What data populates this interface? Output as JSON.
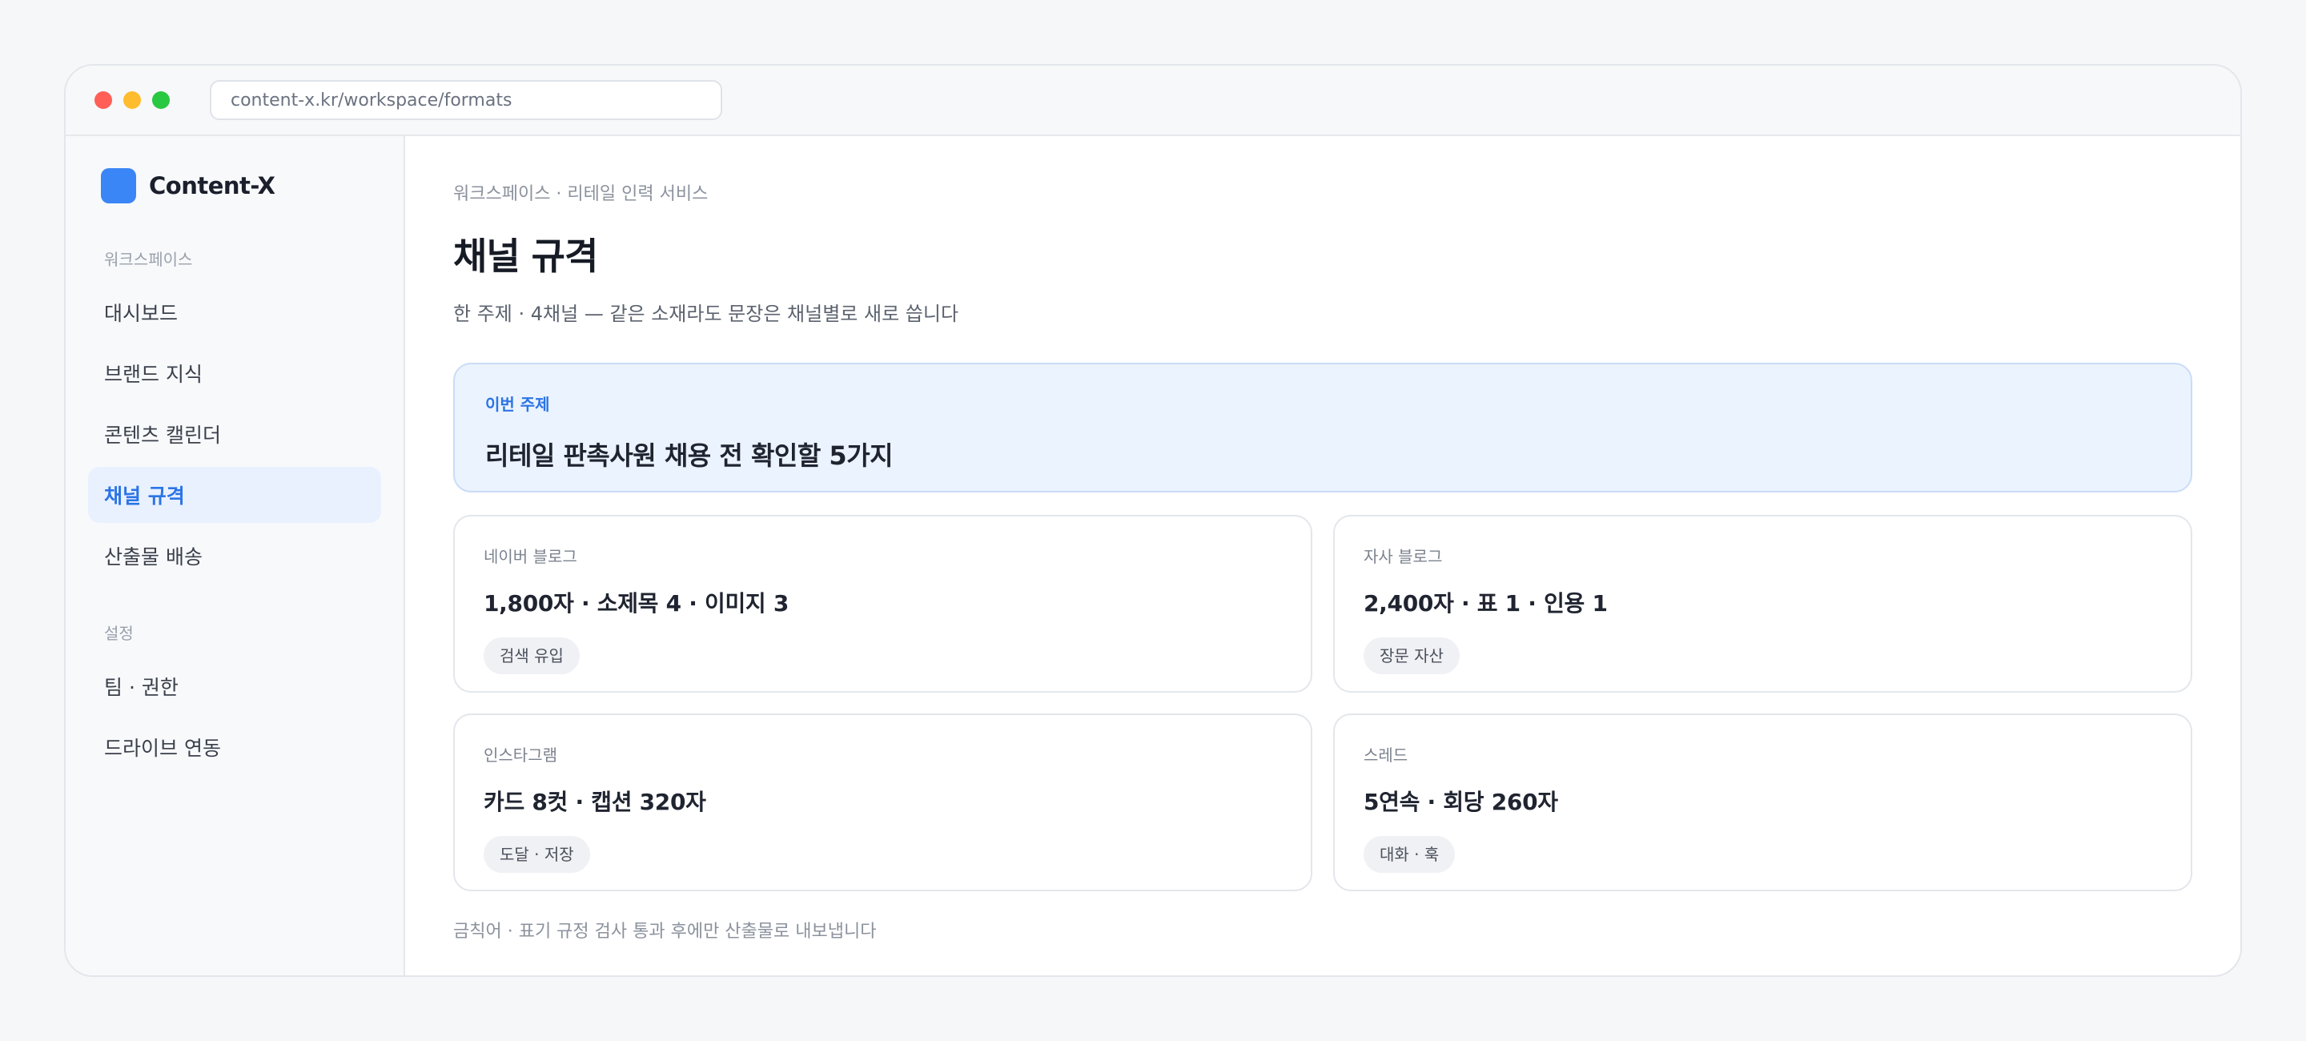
{
  "window": {
    "url": "content-x.kr/workspace/formats"
  },
  "sidebar": {
    "brand": "Content-X",
    "sections": [
      {
        "label": "워크스페이스",
        "items": [
          {
            "label": "대시보드",
            "active": false
          },
          {
            "label": "브랜드 지식",
            "active": false
          },
          {
            "label": "콘텐츠 캘린더",
            "active": false
          },
          {
            "label": "채널 규격",
            "active": true
          },
          {
            "label": "산출물 배송",
            "active": false
          }
        ]
      },
      {
        "label": "설정",
        "items": [
          {
            "label": "팀 · 권한",
            "active": false
          },
          {
            "label": "드라이브 연동",
            "active": false
          }
        ]
      }
    ]
  },
  "main": {
    "breadcrumb": "워크스페이스 · 리테일 인력 서비스",
    "title": "채널 규격",
    "subtitle": "한 주제 · 4채널 — 같은 소재라도 문장은 채널별로 새로 씁니다",
    "topic": {
      "label": "이번 주제",
      "title": "리테일 판촉사원 채용 전 확인할 5가지"
    },
    "channels": [
      {
        "name": "네이버 블로그",
        "spec": "1,800자 · 소제목 4 · 이미지 3",
        "tag": "검색 유입"
      },
      {
        "name": "자사 블로그",
        "spec": "2,400자 · 표 1 · 인용 1",
        "tag": "장문 자산"
      },
      {
        "name": "인스타그램",
        "spec": "카드 8컷 · 캡션 320자",
        "tag": "도달 · 저장"
      },
      {
        "name": "스레드",
        "spec": "5연속 · 회당 260자",
        "tag": "대화 · 훅"
      }
    ],
    "footer_note": "금칙어 · 표기 규정 검사 통과 후에만 산출물로 내보냅니다"
  },
  "colors": {
    "accent": "#3b86f6",
    "active_text": "#2b74e6",
    "active_bg": "#e9f1fe",
    "topic_bg": "#ebf3fe"
  }
}
